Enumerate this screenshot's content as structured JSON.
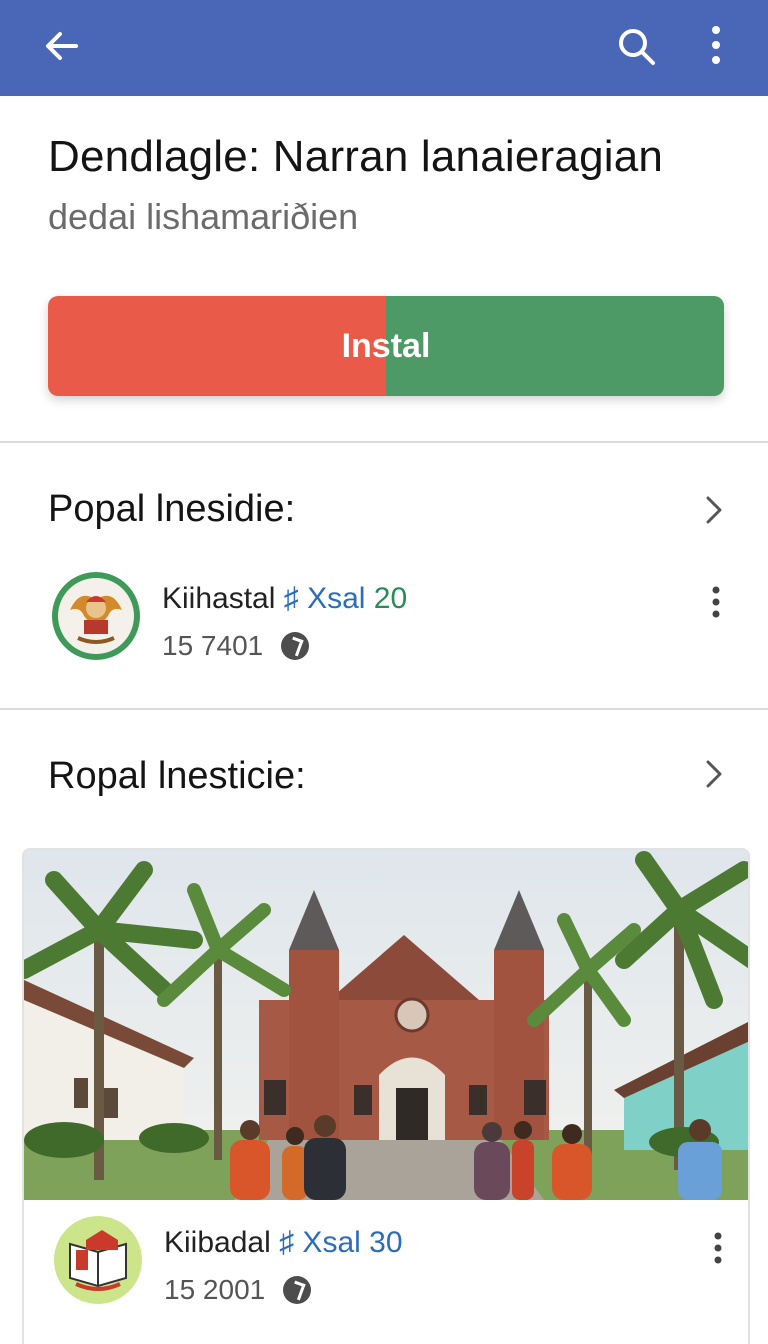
{
  "app_header": {
    "back_icon": "arrow-left-icon",
    "search_icon": "search-icon",
    "more_icon": "more-vertical-icon",
    "color": "#4a66b6"
  },
  "app": {
    "title": "Dendlagle: Narran lanaieragian",
    "subtitle": "dedai lishamariðien",
    "install_label": "Instal",
    "install_colors": [
      "#ea5a48",
      "#4d9a67"
    ]
  },
  "sections": [
    {
      "title": "Popal lnesidie:",
      "items": [
        {
          "name": "Kiihastal",
          "tag": "♯ Xsal",
          "number": "20",
          "meta": "15 7401",
          "icon": "garuda-emblem-icon"
        }
      ]
    },
    {
      "title": "Ropal lnesticie:",
      "items": [
        {
          "name": "Kiibadal",
          "tag": "♯ Xsal",
          "number": "30",
          "meta": "15 2001",
          "icon": "school-book-emblem-icon"
        }
      ]
    }
  ]
}
